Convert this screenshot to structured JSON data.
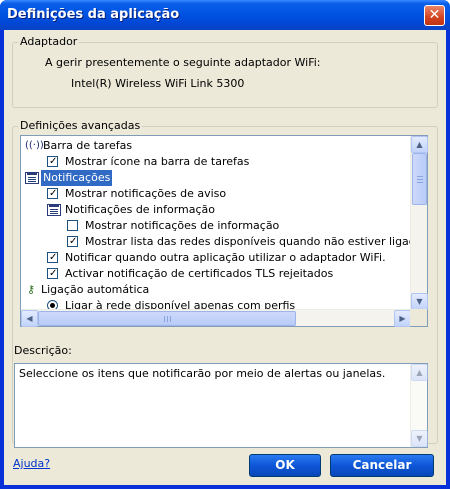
{
  "window": {
    "title": "Definições da aplicação",
    "close_glyph": "✕"
  },
  "adapter": {
    "group_label": "Adaptador",
    "line1": "A gerir presentemente o seguinte adaptador WiFi:",
    "line2": "Intel(R) Wireless WiFi Link 5300"
  },
  "advanced": {
    "group_label": "Definições avançadas",
    "items": [
      {
        "label": "Barra de tarefas",
        "control": "antenna-icon"
      },
      {
        "label": "Mostrar ícone na barra de tarefas",
        "control": "checkbox",
        "checked": true
      },
      {
        "label": "Notificações",
        "control": "list-icon",
        "selected": true
      },
      {
        "label": "Mostrar notificações de aviso",
        "control": "checkbox",
        "checked": true
      },
      {
        "label": "Notificações de informação",
        "control": "list-icon"
      },
      {
        "label": "Mostrar notificações de informação",
        "control": "checkbox",
        "checked": false
      },
      {
        "label": "Mostrar lista das redes disponíveis quando não estiver ligado.",
        "control": "checkbox",
        "checked": true
      },
      {
        "label": "Notificar quando outra aplicação utilizar o adaptador WiFi.",
        "control": "checkbox",
        "checked": true
      },
      {
        "label": "Activar notificação de certificados TLS rejeitados",
        "control": "checkbox",
        "checked": true
      },
      {
        "label": "Ligação automática",
        "control": "key-icon"
      },
      {
        "label": "Ligar à rede disponível apenas com perfis",
        "control": "radio",
        "checked": true
      }
    ]
  },
  "description": {
    "label": "Descrição:",
    "text": "Seleccione os itens que notificarão por meio de alertas ou janelas."
  },
  "footer": {
    "help_link": "Ajuda?",
    "ok_label": "OK",
    "cancel_label": "Cancelar"
  },
  "scrollbar": {
    "up": "▲",
    "down": "▼",
    "left": "◀",
    "right": "▶"
  },
  "colors": {
    "accent": "#0054e3",
    "selection": "#316ac5",
    "face": "#ece9d8"
  }
}
